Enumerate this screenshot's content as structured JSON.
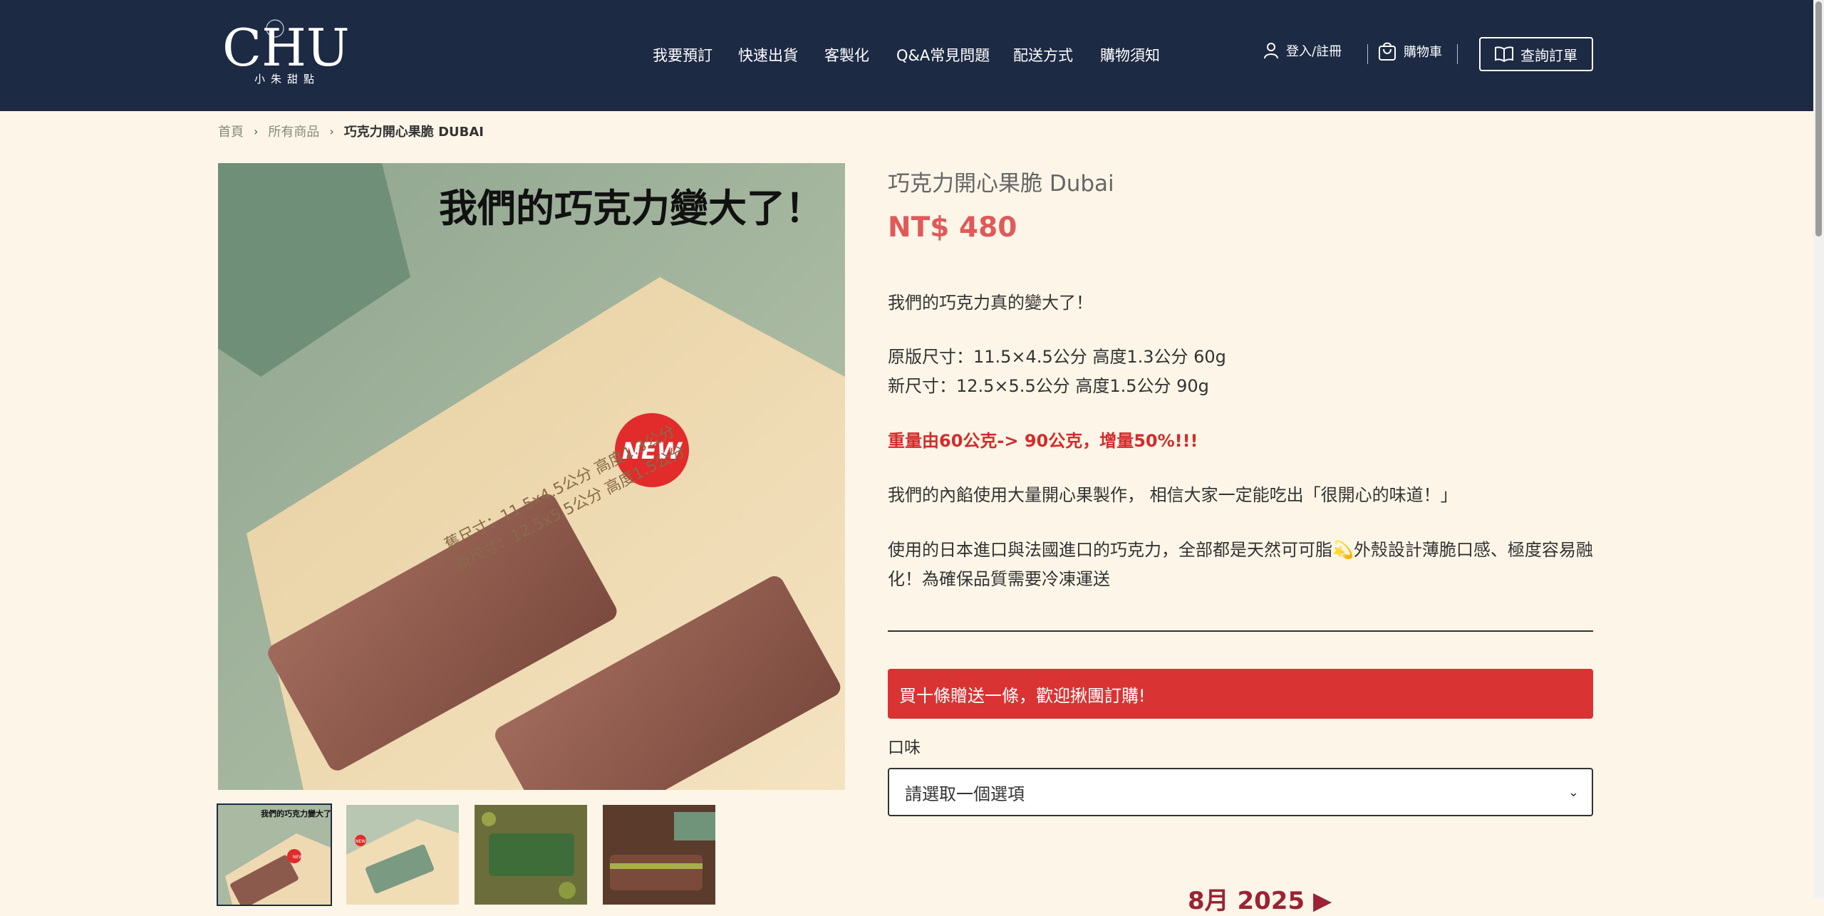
{
  "header": {
    "logo_letters": "CHU",
    "logo_sub": "小朱甜點",
    "nav": [
      "我要預訂",
      "快速出貨",
      "客製化",
      "Q&A常見問題",
      "配送方式",
      "購物須知"
    ],
    "login": "登入/註冊",
    "cart": "購物車",
    "order_lookup": "查詢訂單"
  },
  "breadcrumb": {
    "home": "首頁",
    "all": "所有商品",
    "current": "巧克力開心果脆 DUBAI"
  },
  "main_image": {
    "headline": "我們的巧克力變大了！",
    "old_size": "舊尺寸：11.5x4.5公分 高度1.3公分",
    "new_size": "新尺寸：12.5x5.5公分 高度1.5公分",
    "badge": "NEW"
  },
  "thumbs": [
    {
      "caption": "我們的巧克力變大了！",
      "badge": "NEW"
    },
    {
      "badge": "NEW"
    },
    {},
    {}
  ],
  "product": {
    "title": "巧克力開心果脆 Dubai",
    "price": "NT$ 480",
    "desc1": "我們的巧克力真的變大了！",
    "desc2": "原版尺寸：11.5×4.5公分 高度1.3公分 60g",
    "desc3": "新尺寸：12.5×5.5公分 高度1.5公分 90g",
    "desc_red": "重量由60公克-> 90公克，增量50%!!!",
    "desc4": "我們的內餡使用大量開心果製作， 相信大家一定能吃出「很開心的味道！」",
    "desc5a": "使用的日本進口與法國進口的巧克力，全部都是天然可可脂",
    "desc5emoji": "💫",
    "desc5b": "外殼設計薄脆口感、極度容易融",
    "desc6": "化！為確保品質需要冷凍運送",
    "promo": "買十條贈送一條，歡迎揪團訂購!",
    "flavor_label": "口味",
    "select_placeholder": "請選取一個選項",
    "calendar_month": "8月 2025 ▶"
  }
}
